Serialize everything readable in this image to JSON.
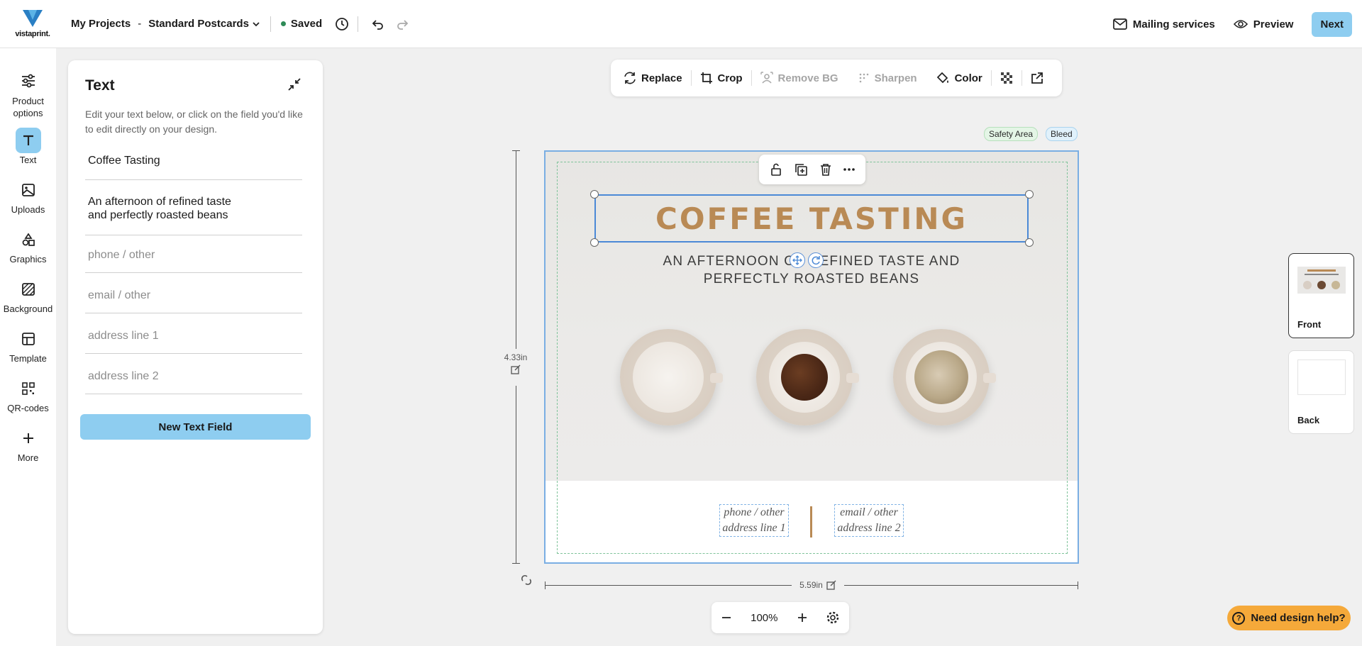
{
  "header": {
    "logo_text": "vistaprint.",
    "breadcrumb": "My Projects",
    "separator": "-",
    "product": "Standard Postcards",
    "status": "Saved",
    "mailing": "Mailing services",
    "preview": "Preview",
    "next": "Next"
  },
  "rail": [
    {
      "label": "Product options",
      "icon": "sliders-icon"
    },
    {
      "label": "Text",
      "icon": "text-icon"
    },
    {
      "label": "Uploads",
      "icon": "image-icon"
    },
    {
      "label": "Graphics",
      "icon": "shapes-icon"
    },
    {
      "label": "Background",
      "icon": "background-icon"
    },
    {
      "label": "Template",
      "icon": "template-icon"
    },
    {
      "label": "QR-codes",
      "icon": "qr-icon"
    },
    {
      "label": "More",
      "icon": "plus-icon"
    }
  ],
  "panel": {
    "title": "Text",
    "help": "Edit your text below, or click on the field you'd like to edit directly on your design.",
    "fields": [
      {
        "value": "Coffee Tasting",
        "placeholder": ""
      },
      {
        "value": "An afternoon of refined taste\nand perfectly roasted beans",
        "placeholder": ""
      },
      {
        "value": "",
        "placeholder": "phone / other"
      },
      {
        "value": "",
        "placeholder": "email / other"
      },
      {
        "value": "",
        "placeholder": "address line 1"
      },
      {
        "value": "",
        "placeholder": "address line 2"
      }
    ],
    "new_field_button": "New Text Field"
  },
  "toolbar": {
    "replace": "Replace",
    "crop": "Crop",
    "remove_bg": "Remove BG",
    "sharpen": "Sharpen",
    "color": "Color"
  },
  "tags": {
    "safety": "Safety Area",
    "bleed": "Bleed"
  },
  "rulers": {
    "height": "4.33in",
    "width": "5.59in"
  },
  "design": {
    "title": "COFFEE TASTING",
    "subtitle_line1": "AN AFTERNOON OF REFINED TASTE AND",
    "subtitle_line2": "PERFECTLY ROASTED BEANS",
    "phone": "phone / other",
    "address1": "address line 1",
    "email": "email / other",
    "address2": "address line 2",
    "accent_color": "#b98a55"
  },
  "zoom": {
    "level": "100%"
  },
  "pages": {
    "front": "Front",
    "back": "Back"
  },
  "help_button": "Need design help?",
  "colors": {
    "primary_button": "#8ecdf0",
    "help_button": "#f5a93a",
    "selection": "#4b89d6"
  }
}
